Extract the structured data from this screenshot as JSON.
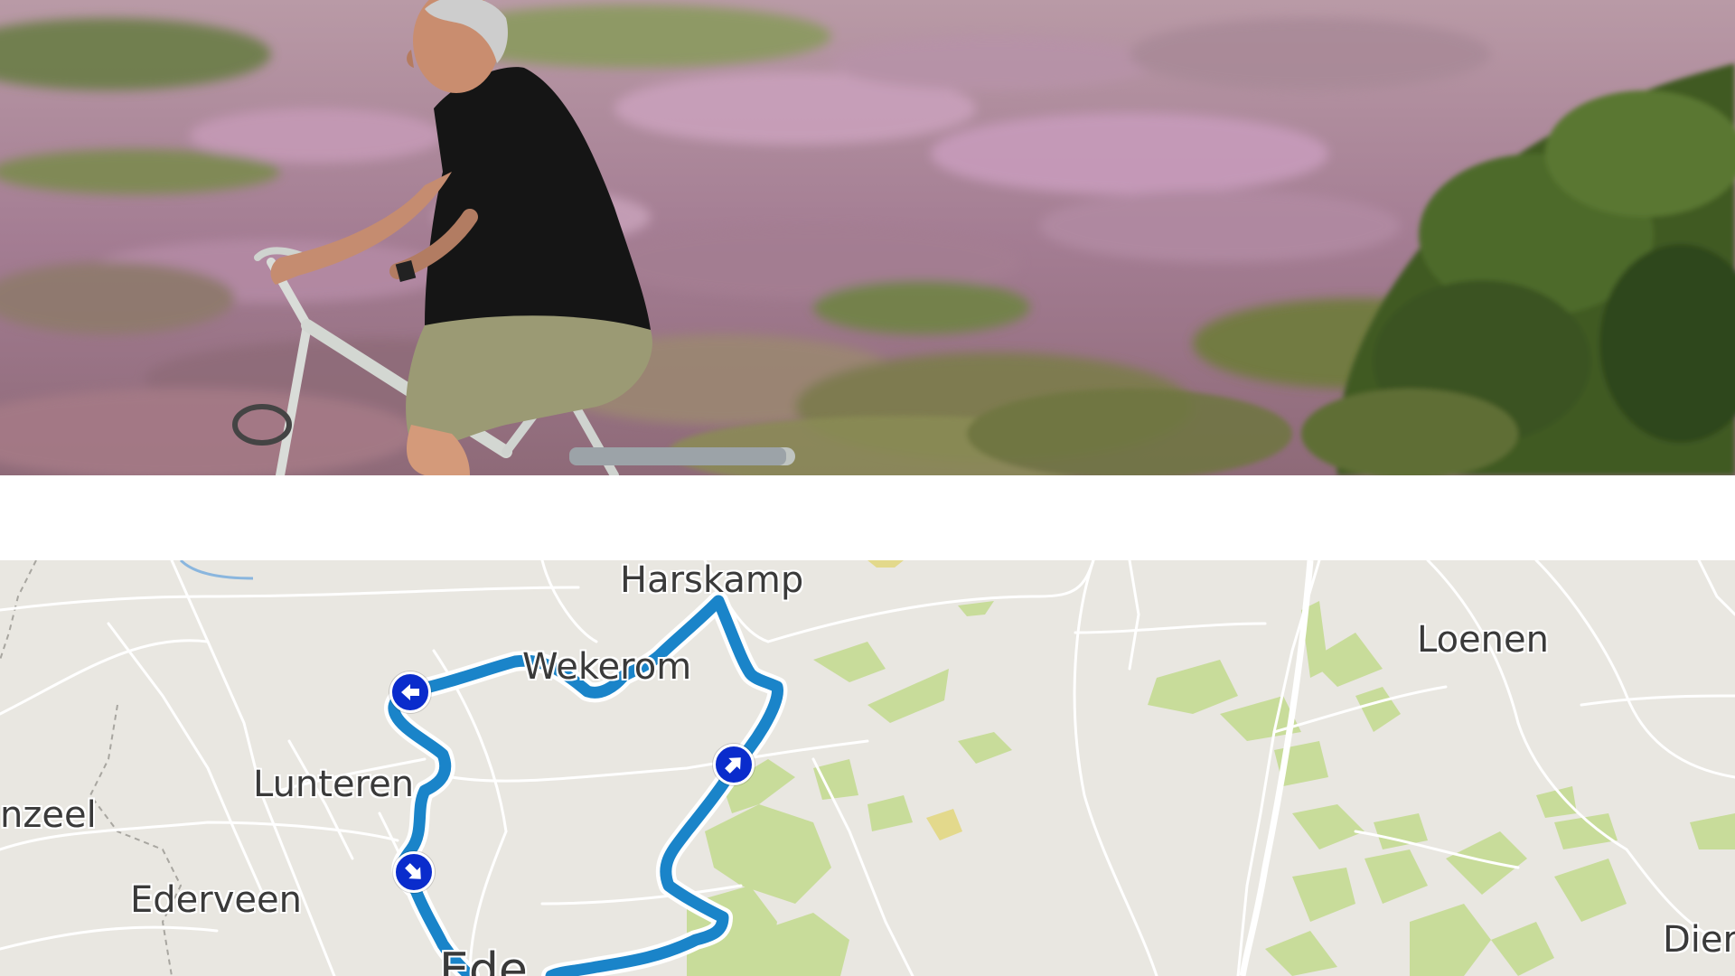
{
  "hero": {
    "image": "cyclist-riding-through-blooming-heather",
    "colors": {
      "heather": "#a97c95",
      "grass": "#6f7f45",
      "shirt": "#151515",
      "shorts": "#9a9a72"
    }
  },
  "map": {
    "colors": {
      "background": "#e9e7e1",
      "road": "#ffffff",
      "forest": "#c8dc9a",
      "route": "#1a84c9",
      "route_casing": "#ffffff",
      "marker": "#0a2ccc",
      "label": "#3a3a3a"
    },
    "places": [
      {
        "id": "harskamp",
        "name": "Harskamp"
      },
      {
        "id": "wekerom",
        "name": "Wekerom"
      },
      {
        "id": "loenen",
        "name": "Loenen"
      },
      {
        "id": "lunteren",
        "name": "Lunteren"
      },
      {
        "id": "renswoude",
        "name": "nzeel"
      },
      {
        "id": "ederveen",
        "name": "Ederveen"
      },
      {
        "id": "ede",
        "name": "Ede"
      },
      {
        "id": "dieren",
        "name": "Dier"
      }
    ],
    "markers": [
      {
        "id": "turn-left",
        "icon": "arrow-left-icon"
      },
      {
        "id": "turn-up-right",
        "icon": "arrow-up-right-icon"
      },
      {
        "id": "turn-down-right",
        "icon": "arrow-down-right-icon"
      }
    ]
  }
}
